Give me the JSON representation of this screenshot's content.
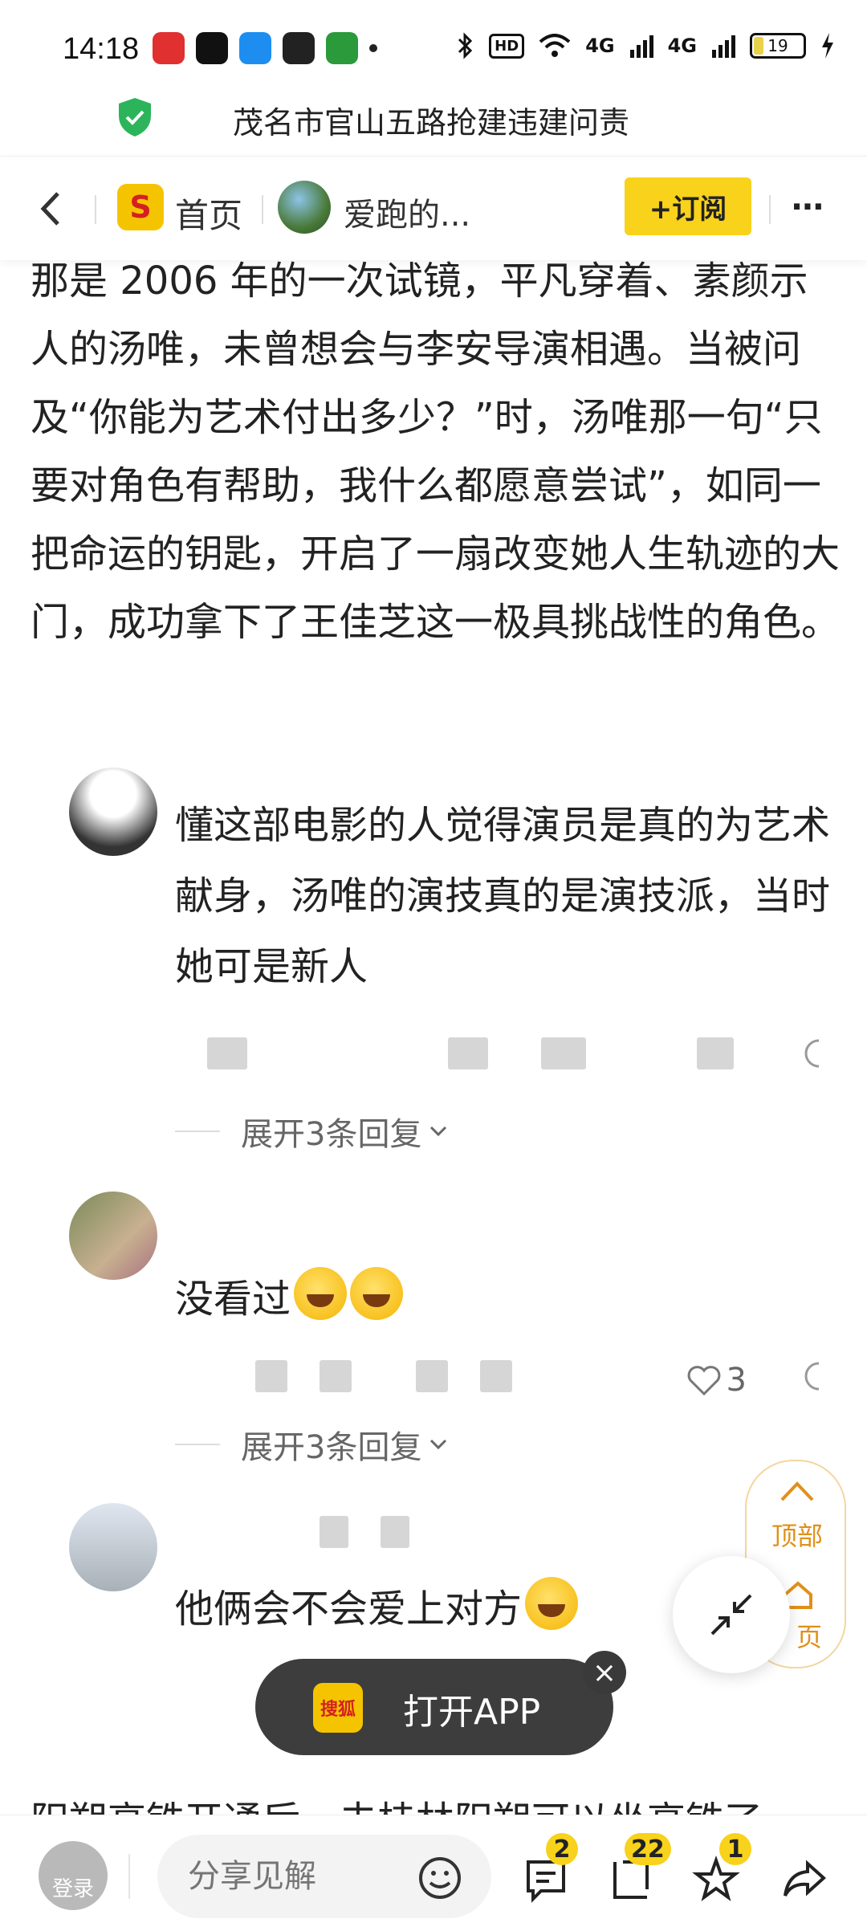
{
  "status_bar": {
    "time": "14:18",
    "app_icons": [
      "app-a",
      "app-b",
      "app-c",
      "app-d",
      "app-e"
    ],
    "hd_label": "HD",
    "net1": "4G",
    "net2": "4G",
    "battery": "19",
    "battery_level": 0.19
  },
  "security_banner": {
    "title": "茂名市官山五路抢建违建问责"
  },
  "header": {
    "home_label": "首页",
    "author_name": "爱跑的...",
    "subscribe_label": "+订阅",
    "more_label": "⋯"
  },
  "article": {
    "text": "那是 2006 年的一次试镜，平凡穿着、素颜示人的汤唯，未曾想会与李安导演相遇。当被问及“你能为艺术付出多少？”时，汤唯那一句“只要对角色有帮助，我什么都愿意尝试”，如同一把命运的钥匙，开启了一扇改变她人生轨迹的大门，成功拿下了王佳芝这一极具挑战性的角色。"
  },
  "comments": [
    {
      "text": "懂这部电影的人觉得演员是真的为艺术献身，汤唯的演技真的是演技派，当时她可是新人",
      "expand_label": "展开3条回复"
    },
    {
      "text": "没看过",
      "like_count": "3",
      "expand_label": "展开3条回复"
    },
    {
      "text": "他俩会不会爱上对方"
    }
  ],
  "float_panel": {
    "top_label": "顶部",
    "home_label": "页"
  },
  "open_app": {
    "logo": "搜狐",
    "label": "打开APP"
  },
  "peek_text": "阳朔高铁开通后，去桂林阳朔可以坐高铁了",
  "bottom_bar": {
    "login_label": "登录",
    "share_placeholder": "分享见解",
    "comments_badge": "2",
    "bookmark_badge": "22",
    "star_badge": "1"
  },
  "colors": {
    "brand_yellow": "#f8d21b",
    "accent_orange": "#e0901a",
    "shield_green": "#2bb45a"
  }
}
